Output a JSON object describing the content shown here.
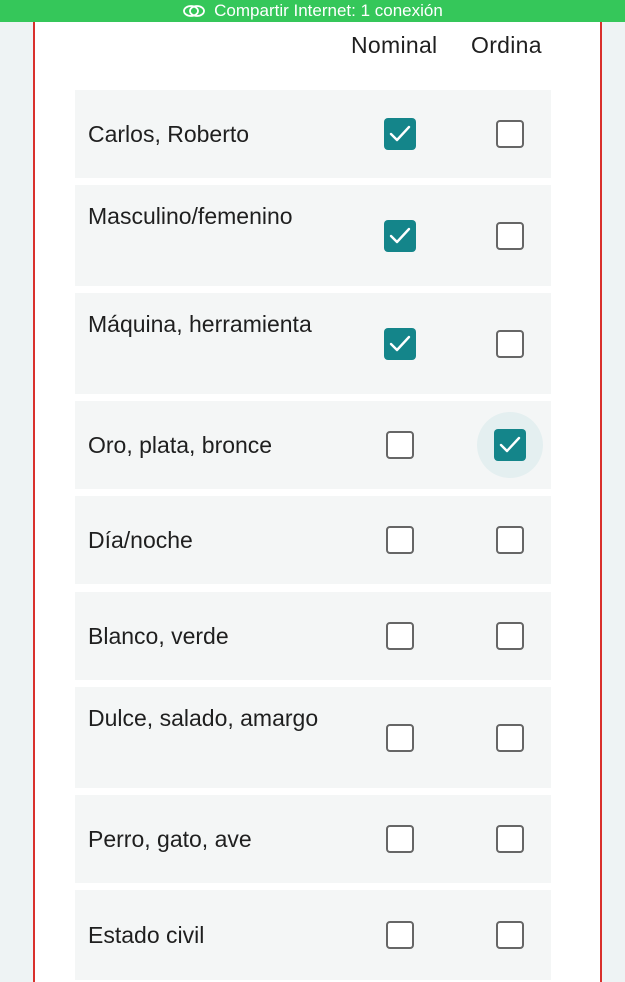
{
  "status_bar": {
    "text": "Compartir Internet: 1 conexión",
    "icon": "link-icon"
  },
  "columns": {
    "nominal": "Nominal",
    "ordinal": "Ordina"
  },
  "colors": {
    "status_bar": "#35c75a",
    "checked": "#14858a",
    "border": "#d9302c"
  },
  "rows": [
    {
      "label": "Carlos, Roberto",
      "nominal": true,
      "ordinal": false
    },
    {
      "label": "Masculino/femenino",
      "nominal": true,
      "ordinal": false
    },
    {
      "label": "Máquina, herramienta",
      "nominal": true,
      "ordinal": false
    },
    {
      "label": "Oro, plata, bronce",
      "nominal": false,
      "ordinal": true,
      "focused": "ordinal"
    },
    {
      "label": "Día/noche",
      "nominal": false,
      "ordinal": false
    },
    {
      "label": "Blanco, verde",
      "nominal": false,
      "ordinal": false
    },
    {
      "label": "Dulce, salado, amargo",
      "nominal": false,
      "ordinal": false
    },
    {
      "label": "Perro, gato, ave",
      "nominal": false,
      "ordinal": false
    },
    {
      "label": "Estado civil",
      "nominal": false,
      "ordinal": false
    }
  ]
}
